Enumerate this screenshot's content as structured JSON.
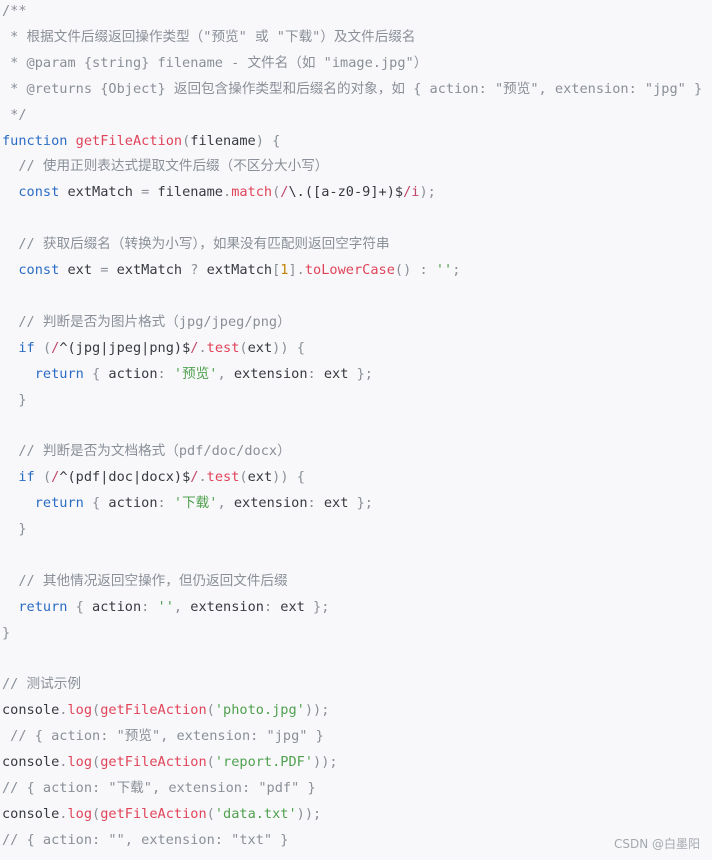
{
  "code": {
    "language": "javascript",
    "line_count": 33,
    "lines": [
      [
        [
          "comment",
          "/**"
        ]
      ],
      [
        [
          "comment",
          " * 根据文件后缀返回操作类型（\"预览\" 或 \"下载\"）及文件后缀名"
        ]
      ],
      [
        [
          "comment",
          " * @param {string} filename - 文件名（如 \"image.jpg\"）"
        ]
      ],
      [
        [
          "comment",
          " * @returns {Object} 返回包含操作类型和后缀名的对象，如 { action: \"预览\", extension: \"jpg\" }"
        ]
      ],
      [
        [
          "comment",
          " */"
        ]
      ],
      [
        [
          "keyword",
          "function"
        ],
        [
          "plain",
          " "
        ],
        [
          "func",
          "getFileAction"
        ],
        [
          "punct",
          "("
        ],
        [
          "plain",
          "filename"
        ],
        [
          "punct",
          ")"
        ],
        [
          "plain",
          " "
        ],
        [
          "punct",
          "{"
        ]
      ],
      [
        [
          "plain",
          "  "
        ],
        [
          "comment",
          "// 使用正则表达式提取文件后缀（不区分大小写）"
        ]
      ],
      [
        [
          "plain",
          "  "
        ],
        [
          "keyword",
          "const"
        ],
        [
          "plain",
          " extMatch "
        ],
        [
          "punct",
          "="
        ],
        [
          "plain",
          " filename"
        ],
        [
          "punct",
          "."
        ],
        [
          "func",
          "match"
        ],
        [
          "punct",
          "("
        ],
        [
          "regex",
          "/"
        ],
        [
          "plain",
          "\\.([a-z0-9]+)$"
        ],
        [
          "regex",
          "/i"
        ],
        [
          "punct",
          ")"
        ],
        [
          "punct",
          ";"
        ]
      ],
      [],
      [
        [
          "plain",
          "  "
        ],
        [
          "comment",
          "// 获取后缀名（转换为小写），如果没有匹配则返回空字符串"
        ]
      ],
      [
        [
          "plain",
          "  "
        ],
        [
          "keyword",
          "const"
        ],
        [
          "plain",
          " ext "
        ],
        [
          "punct",
          "="
        ],
        [
          "plain",
          " extMatch "
        ],
        [
          "punct",
          "?"
        ],
        [
          "plain",
          " extMatch"
        ],
        [
          "punct",
          "["
        ],
        [
          "number",
          "1"
        ],
        [
          "punct",
          "]"
        ],
        [
          "punct",
          "."
        ],
        [
          "func",
          "toLowerCase"
        ],
        [
          "punct",
          "()"
        ],
        [
          "plain",
          " "
        ],
        [
          "punct",
          ":"
        ],
        [
          "plain",
          " "
        ],
        [
          "string",
          "''"
        ],
        [
          "punct",
          ";"
        ]
      ],
      [],
      [
        [
          "plain",
          "  "
        ],
        [
          "comment",
          "// 判断是否为图片格式（jpg/jpeg/png）"
        ]
      ],
      [
        [
          "plain",
          "  "
        ],
        [
          "keyword",
          "if"
        ],
        [
          "plain",
          " "
        ],
        [
          "punct",
          "("
        ],
        [
          "regex",
          "/"
        ],
        [
          "plain",
          "^(jpg|jpeg|png)$"
        ],
        [
          "regex",
          "/"
        ],
        [
          "punct",
          "."
        ],
        [
          "func",
          "test"
        ],
        [
          "punct",
          "("
        ],
        [
          "plain",
          "ext"
        ],
        [
          "punct",
          "))"
        ],
        [
          "plain",
          " "
        ],
        [
          "punct",
          "{"
        ]
      ],
      [
        [
          "plain",
          "    "
        ],
        [
          "keyword",
          "return"
        ],
        [
          "plain",
          " "
        ],
        [
          "punct",
          "{"
        ],
        [
          "plain",
          " action"
        ],
        [
          "punct",
          ":"
        ],
        [
          "plain",
          " "
        ],
        [
          "string",
          "'预览'"
        ],
        [
          "punct",
          ","
        ],
        [
          "plain",
          " extension"
        ],
        [
          "punct",
          ":"
        ],
        [
          "plain",
          " ext "
        ],
        [
          "punct",
          "};"
        ]
      ],
      [
        [
          "plain",
          "  "
        ],
        [
          "punct",
          "}"
        ]
      ],
      [],
      [
        [
          "plain",
          "  "
        ],
        [
          "comment",
          "// 判断是否为文档格式（pdf/doc/docx）"
        ]
      ],
      [
        [
          "plain",
          "  "
        ],
        [
          "keyword",
          "if"
        ],
        [
          "plain",
          " "
        ],
        [
          "punct",
          "("
        ],
        [
          "regex",
          "/"
        ],
        [
          "plain",
          "^(pdf|doc|docx)$"
        ],
        [
          "regex",
          "/"
        ],
        [
          "punct",
          "."
        ],
        [
          "func",
          "test"
        ],
        [
          "punct",
          "("
        ],
        [
          "plain",
          "ext"
        ],
        [
          "punct",
          "))"
        ],
        [
          "plain",
          " "
        ],
        [
          "punct",
          "{"
        ]
      ],
      [
        [
          "plain",
          "    "
        ],
        [
          "keyword",
          "return"
        ],
        [
          "plain",
          " "
        ],
        [
          "punct",
          "{"
        ],
        [
          "plain",
          " action"
        ],
        [
          "punct",
          ":"
        ],
        [
          "plain",
          " "
        ],
        [
          "string",
          "'下载'"
        ],
        [
          "punct",
          ","
        ],
        [
          "plain",
          " extension"
        ],
        [
          "punct",
          ":"
        ],
        [
          "plain",
          " ext "
        ],
        [
          "punct",
          "};"
        ]
      ],
      [
        [
          "plain",
          "  "
        ],
        [
          "punct",
          "}"
        ]
      ],
      [],
      [
        [
          "plain",
          "  "
        ],
        [
          "comment",
          "// 其他情况返回空操作，但仍返回文件后缀"
        ]
      ],
      [
        [
          "plain",
          "  "
        ],
        [
          "keyword",
          "return"
        ],
        [
          "plain",
          " "
        ],
        [
          "punct",
          "{"
        ],
        [
          "plain",
          " action"
        ],
        [
          "punct",
          ":"
        ],
        [
          "plain",
          " "
        ],
        [
          "string",
          "''"
        ],
        [
          "punct",
          ","
        ],
        [
          "plain",
          " extension"
        ],
        [
          "punct",
          ":"
        ],
        [
          "plain",
          " ext "
        ],
        [
          "punct",
          "};"
        ]
      ],
      [
        [
          "punct",
          "}"
        ]
      ],
      [],
      [
        [
          "comment",
          "// 测试示例"
        ]
      ],
      [
        [
          "plain",
          "console"
        ],
        [
          "punct",
          "."
        ],
        [
          "func",
          "log"
        ],
        [
          "punct",
          "("
        ],
        [
          "func",
          "getFileAction"
        ],
        [
          "punct",
          "("
        ],
        [
          "string",
          "'photo.jpg'"
        ],
        [
          "punct",
          "));"
        ]
      ],
      [
        [
          "comment",
          " // { action: \"预览\", extension: \"jpg\" }"
        ]
      ],
      [
        [
          "plain",
          "console"
        ],
        [
          "punct",
          "."
        ],
        [
          "func",
          "log"
        ],
        [
          "punct",
          "("
        ],
        [
          "func",
          "getFileAction"
        ],
        [
          "punct",
          "("
        ],
        [
          "string",
          "'report.PDF'"
        ],
        [
          "punct",
          "));"
        ]
      ],
      [
        [
          "comment",
          "// { action: \"下载\", extension: \"pdf\" }"
        ]
      ],
      [
        [
          "plain",
          "console"
        ],
        [
          "punct",
          "."
        ],
        [
          "func",
          "log"
        ],
        [
          "punct",
          "("
        ],
        [
          "func",
          "getFileAction"
        ],
        [
          "punct",
          "("
        ],
        [
          "string",
          "'data.txt'"
        ],
        [
          "punct",
          "));"
        ]
      ],
      [
        [
          "comment",
          "// { action: \"\", extension: \"txt\" }"
        ]
      ]
    ]
  },
  "colors": {
    "background": "#f8f8fa",
    "comment": "#8a8f98",
    "keyword": "#2b6cc4",
    "function": "#e0445a",
    "string": "#50a14f",
    "regex": "#c0486a",
    "number": "#c18401",
    "plain": "#383a42"
  },
  "watermark": {
    "text": "CSDN @白墨阳"
  }
}
